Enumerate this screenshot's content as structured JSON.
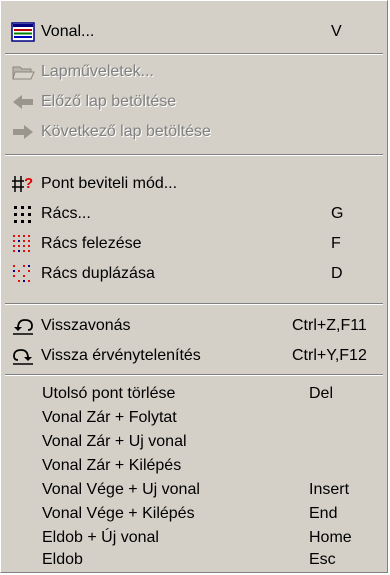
{
  "menu": {
    "items": [
      {
        "label": "Vonal...",
        "shortcut": "V",
        "icon": "line-settings-icon",
        "enabled": true
      },
      {
        "label": "Lapműveletek...",
        "shortcut": "",
        "icon": "folder-open-icon",
        "enabled": false
      },
      {
        "label": "Előző lap betöltése",
        "shortcut": "",
        "icon": "arrow-left-icon",
        "enabled": false
      },
      {
        "label": "Következő lap betöltése",
        "shortcut": "",
        "icon": "arrow-right-icon",
        "enabled": false
      },
      {
        "label": "Pont beviteli mód...",
        "shortcut": "",
        "icon": "point-input-icon",
        "enabled": true
      },
      {
        "label": "Rács...",
        "shortcut": "G",
        "icon": "grid-icon",
        "enabled": true
      },
      {
        "label": "Rács felezése",
        "shortcut": "F",
        "icon": "grid-halve-icon",
        "enabled": true
      },
      {
        "label": "Rács duplázása",
        "shortcut": "D",
        "icon": "grid-double-icon",
        "enabled": true
      },
      {
        "label": "Visszavonás",
        "shortcut": "Ctrl+Z,F11",
        "icon": "undo-icon",
        "enabled": true
      },
      {
        "label": "Vissza érvénytelenítés",
        "shortcut": "Ctrl+Y,F12",
        "icon": "redo-icon",
        "enabled": true
      },
      {
        "label": "Utolsó pont törlése",
        "shortcut": "Del",
        "enabled": true
      },
      {
        "label": "Vonal Zár + Folytat",
        "shortcut": "",
        "enabled": true
      },
      {
        "label": "Vonal Zár + Uj vonal",
        "shortcut": "",
        "enabled": true
      },
      {
        "label": "Vonal Zár + Kilépés",
        "shortcut": "",
        "enabled": true
      },
      {
        "label": "Vonal Vége + Uj vonal",
        "shortcut": "Insert",
        "enabled": true
      },
      {
        "label": "Vonal Vége + Kilépés",
        "shortcut": "End",
        "enabled": true
      },
      {
        "label": "Eldob + Új vonal",
        "shortcut": "Home",
        "enabled": true
      },
      {
        "label": "Eldob",
        "shortcut": "Esc",
        "enabled": true
      }
    ]
  },
  "colors": {
    "menu_bg": "#d4d0c8",
    "disabled_text": "#808080",
    "grid_red": "#e01010"
  }
}
